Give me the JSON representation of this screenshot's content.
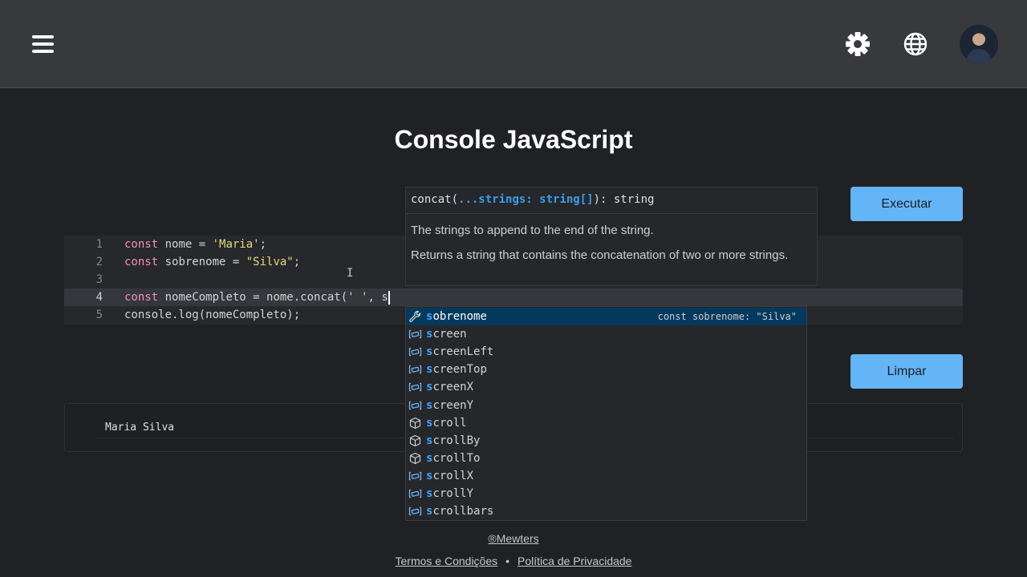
{
  "header": {
    "menu_icon": "hamburger-menu-icon",
    "theme_icon": "gear-icon",
    "language_icon": "globe-icon",
    "avatar_icon": "user-avatar"
  },
  "page": {
    "title": "Console JavaScript"
  },
  "actions": {
    "run_label": "Executar",
    "clear_label": "Limpar"
  },
  "editor": {
    "lines": [
      {
        "number": "1",
        "parts": [
          [
            "kw",
            "const"
          ],
          [
            "plain",
            " nome = "
          ],
          [
            "str",
            "'Maria'"
          ],
          [
            "plain",
            ";"
          ]
        ]
      },
      {
        "number": "2",
        "parts": [
          [
            "kw",
            "const"
          ],
          [
            "plain",
            " sobrenome = "
          ],
          [
            "str",
            "\"Silva\""
          ],
          [
            "plain",
            ";"
          ]
        ]
      },
      {
        "number": "3",
        "parts": []
      },
      {
        "number": "4",
        "parts": [
          [
            "kw",
            "const"
          ],
          [
            "plain",
            " nomeCompleto = nome.concat("
          ],
          [
            "str",
            "' '"
          ],
          [
            "plain",
            ", s"
          ]
        ]
      },
      {
        "number": "5",
        "parts": [
          [
            "plain",
            "console.log(nomeCompleto);"
          ]
        ]
      }
    ]
  },
  "tooltip": {
    "sig_prefix": "concat(",
    "sig_param": "...strings: string[]",
    "sig_suffix": "): string",
    "doc_line1": "The strings to append to the end of the string.",
    "doc_line2": "Returns a string that contains the concatenation of two or more strings."
  },
  "suggestions": [
    {
      "match": "s",
      "rest": "obrenome",
      "kind": "wrench-icon",
      "detail": "const sobrenome: \"Silva\"",
      "active": true
    },
    {
      "match": "s",
      "rest": "creen",
      "kind": "variable-icon"
    },
    {
      "match": "s",
      "rest": "creenLeft",
      "kind": "variable-icon"
    },
    {
      "match": "s",
      "rest": "creenTop",
      "kind": "variable-icon"
    },
    {
      "match": "s",
      "rest": "creenX",
      "kind": "variable-icon"
    },
    {
      "match": "s",
      "rest": "creenY",
      "kind": "variable-icon"
    },
    {
      "match": "s",
      "rest": "croll",
      "kind": "method-cube-icon"
    },
    {
      "match": "s",
      "rest": "crollBy",
      "kind": "method-cube-icon"
    },
    {
      "match": "s",
      "rest": "crollTo",
      "kind": "method-cube-icon"
    },
    {
      "match": "s",
      "rest": "crollX",
      "kind": "variable-icon"
    },
    {
      "match": "s",
      "rest": "crollY",
      "kind": "variable-icon"
    },
    {
      "match": "s",
      "rest": "crollbars",
      "kind": "variable-icon"
    }
  ],
  "output": {
    "text": "Maria Silva"
  },
  "footer": {
    "brand": "®Mewters",
    "terms": "Termos e Condições",
    "separator": "•",
    "privacy": "Política de Privacidade"
  }
}
